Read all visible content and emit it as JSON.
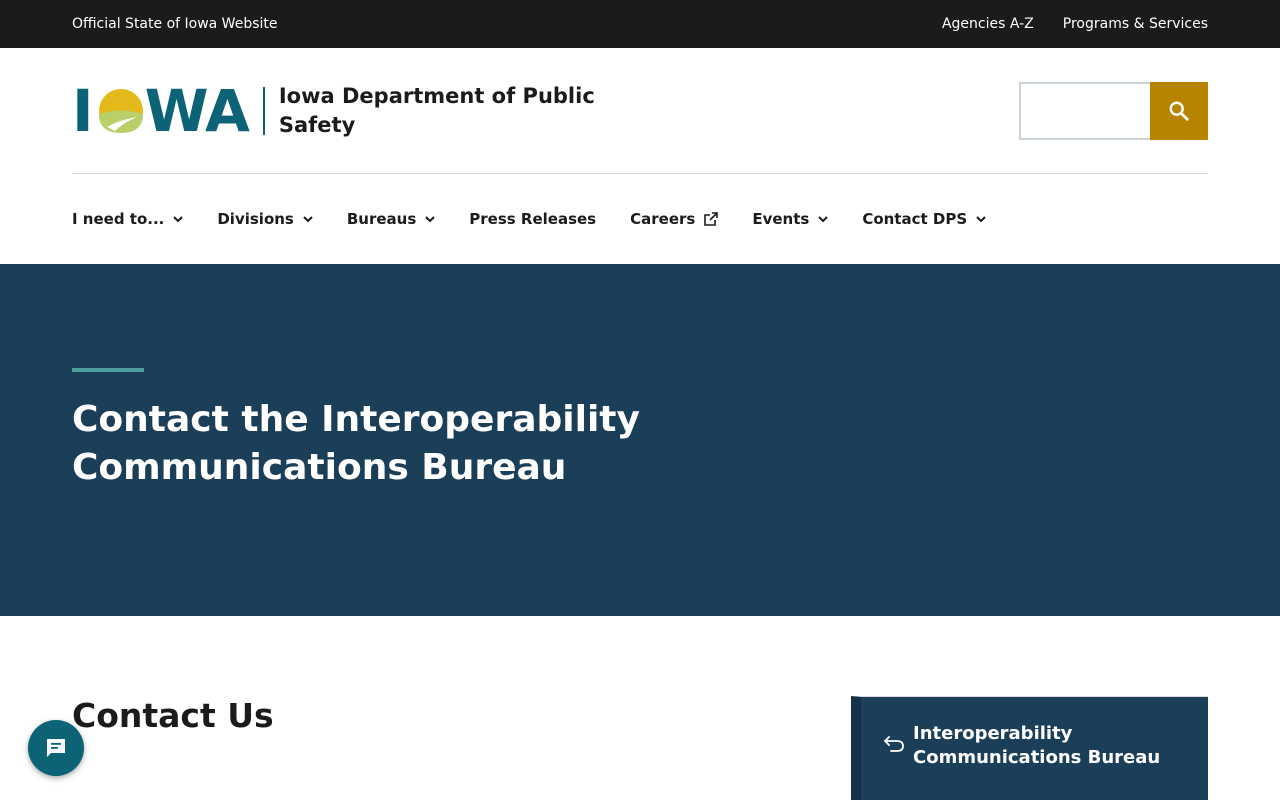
{
  "utility_bar": {
    "official_text": "Official State of Iowa Website",
    "links": [
      "Agencies A-Z",
      "Programs & Services"
    ]
  },
  "header": {
    "logo_text_1": "I",
    "logo_text_2": "WA",
    "agency_name": "Iowa Department of Public Safety",
    "search_placeholder": ""
  },
  "nav": {
    "items": [
      {
        "label": "I need to..."
      },
      {
        "label": "Divisions"
      },
      {
        "label": "Bureaus"
      },
      {
        "label": "Press Releases"
      },
      {
        "label": "Careers"
      },
      {
        "label": "Events"
      },
      {
        "label": "Contact DPS"
      }
    ]
  },
  "hero": {
    "title": "Contact the Interoperability Communications Bureau"
  },
  "content": {
    "section_title": "Contact Us",
    "side_nav_label": "Interoperability Communications Bureau"
  },
  "colors": {
    "utility_bg": "#1b1b1b",
    "brand_teal": "#0d6376",
    "hero_bg": "#1b3e59",
    "accent_gold": "#b88400",
    "hero_rule": "#4f9fa0"
  },
  "icons": {
    "search": "search-icon",
    "chevron": "chevron-down-icon",
    "external": "external-link-icon",
    "back": "back-arrow-icon",
    "chat": "chat-icon"
  }
}
